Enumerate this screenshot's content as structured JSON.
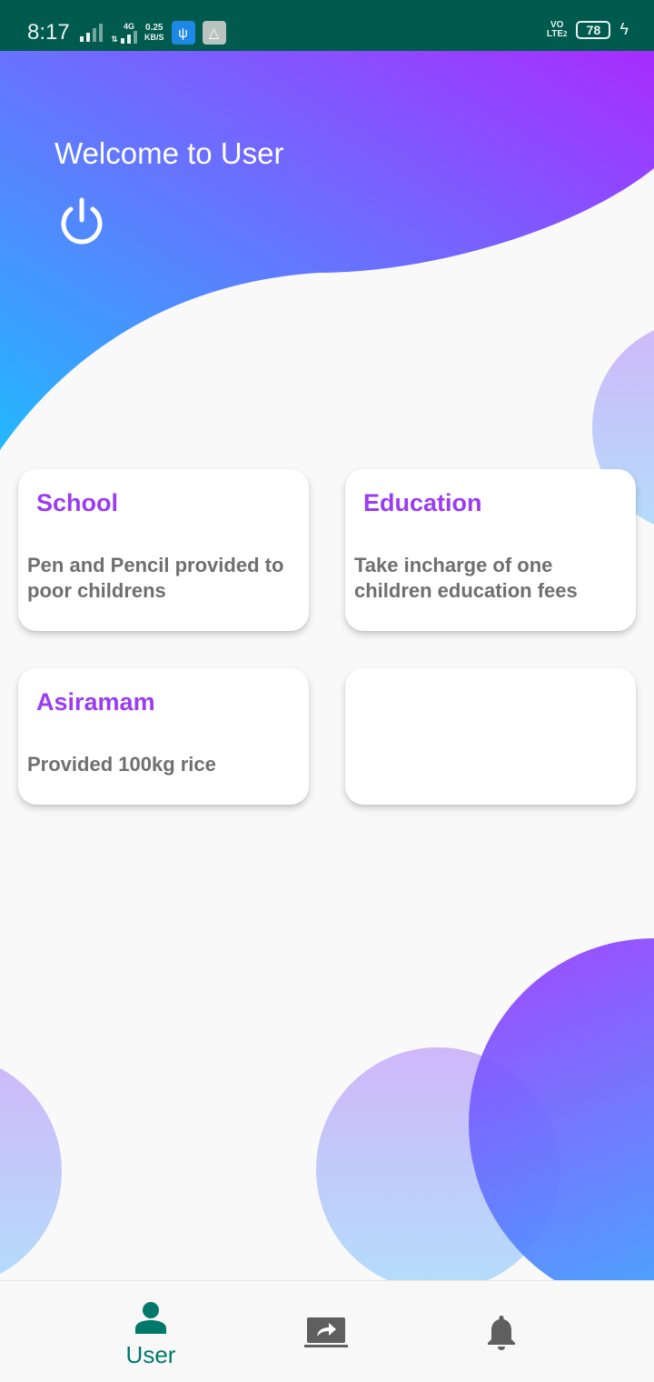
{
  "status_bar": {
    "time": "8:17",
    "network_type": "4G",
    "data_speed_value": "0.25",
    "data_speed_unit": "KB/S",
    "volte_top": "VO",
    "volte_bottom": "LTE",
    "sim_slot": "2",
    "battery_level": "78"
  },
  "header": {
    "welcome_text": "Welcome to User"
  },
  "cards": [
    {
      "title": "School",
      "description": "Pen and Pencil provided to poor childrens"
    },
    {
      "title": "Education",
      "description": "Take incharge of one children education fees"
    },
    {
      "title": "Asiramam",
      "description": "Provided 100kg rice"
    },
    {
      "title": "",
      "description": ""
    }
  ],
  "bottom_nav": {
    "items": [
      {
        "label": "User",
        "icon": "person-icon",
        "active": true
      },
      {
        "label": "",
        "icon": "share-screen-icon",
        "active": false
      },
      {
        "label": "",
        "icon": "bell-icon",
        "active": false
      }
    ]
  },
  "colors": {
    "status_bar": "#005a4e",
    "gradient_start": "#29b6ff",
    "gradient_end": "#a12cff",
    "card_title": "#9b3cf0",
    "card_text": "#6f6f6f",
    "nav_active": "#00796b",
    "nav_inactive": "#5f5f5f"
  }
}
